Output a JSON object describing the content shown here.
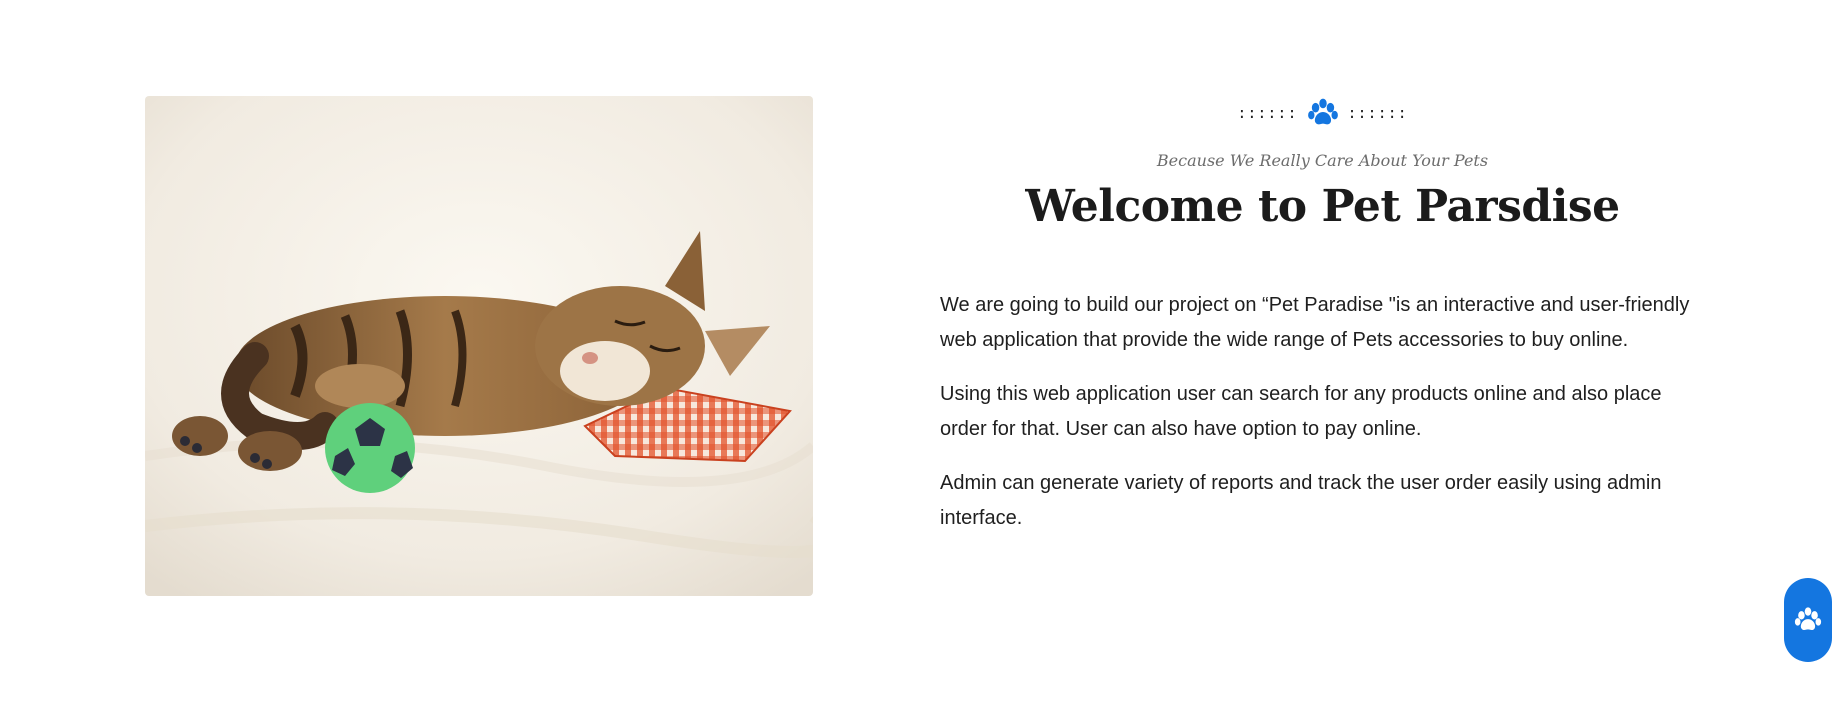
{
  "about": {
    "divider_left": "::::::",
    "divider_icon": "paw-icon",
    "divider_right": "::::::",
    "subtitle": "Because We Really Care About Your Pets",
    "title": "Welcome to Pet Parsdise",
    "paragraphs": [
      "We are going to build our project on “Pet Paradise \"is an interactive and user-friendly web application that provide the wide range of Pets accessories to buy online.",
      "Using this web application user can search for any products online and also place order for that. User can also have option to pay online.",
      "Admin can generate variety of reports and track the user order easily using admin interface."
    ]
  },
  "image": {
    "subject": "kitten-sleeping-with-ball-and-pillow"
  },
  "floating_button": {
    "icon": "paw-icon"
  },
  "colors": {
    "accent": "#1476e0",
    "title": "#1b1b1b",
    "subtitle": "#6c6c6c",
    "body_text": "#1f1f1f"
  }
}
